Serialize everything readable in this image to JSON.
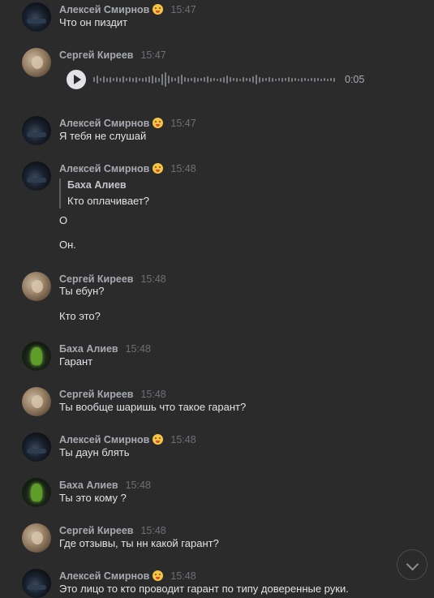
{
  "messages": [
    {
      "author": "Алексей Смирнов",
      "has_emoji": true,
      "time": "15:47",
      "texts": [
        "Что он пиздит"
      ]
    },
    {
      "author": "Сергей Киреев",
      "has_emoji": false,
      "time": "15:47",
      "voice": {
        "duration": "0:05"
      }
    },
    {
      "author": "Алексей Смирнов",
      "has_emoji": true,
      "time": "15:47",
      "texts": [
        "Я тебя не слушай"
      ]
    },
    {
      "author": "Алексей Смирнов",
      "has_emoji": true,
      "time": "15:48",
      "quote": {
        "author": "Баха Алиев",
        "text": "Кто оплачивает?"
      },
      "texts": [
        "О",
        "Он."
      ]
    },
    {
      "author": "Сергей Киреев",
      "has_emoji": false,
      "time": "15:48",
      "texts": [
        "Ты ебун?",
        "Кто это?"
      ]
    },
    {
      "author": "Баха Алиев",
      "has_emoji": false,
      "time": "15:48",
      "texts": [
        "Гарант"
      ]
    },
    {
      "author": "Сергей Киреев",
      "has_emoji": false,
      "time": "15:48",
      "texts": [
        "Ты вообще шаришь что такое гарант?"
      ]
    },
    {
      "author": "Алексей Смирнов",
      "has_emoji": true,
      "time": "15:48",
      "texts": [
        "Ты даун блять"
      ]
    },
    {
      "author": "Баха Алиев",
      "has_emoji": false,
      "time": "15:48",
      "texts": [
        "Ты это кому ?"
      ]
    },
    {
      "author": "Сергей Киреев",
      "has_emoji": false,
      "time": "15:48",
      "texts": [
        "Где отзывы, ты нн какой гарант?"
      ]
    },
    {
      "author": "Алексей Смирнов",
      "has_emoji": true,
      "time": "15:48",
      "texts": [
        "Это лицо то кто проводит гарант по типу доверенные руки."
      ]
    }
  ],
  "icons": {
    "play": "play-icon",
    "scroll_down": "chevron-down-icon",
    "emoji": "tongue-face-emoji"
  },
  "colors": {
    "background": "#2b2b2c",
    "name": "#a7aab0",
    "time": "#6d7075",
    "text": "#e1e3e6"
  }
}
